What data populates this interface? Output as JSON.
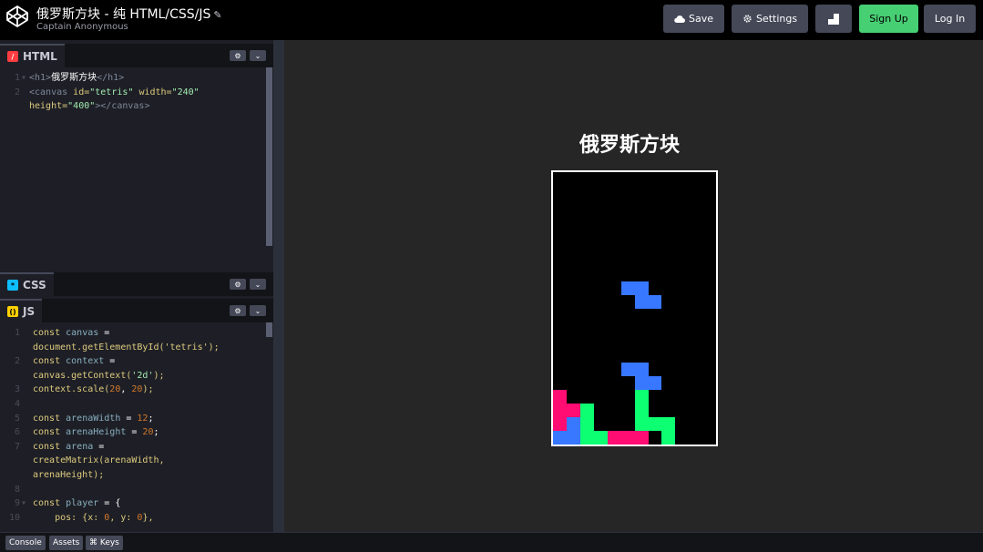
{
  "app": {
    "title": "俄罗斯方块 - 纯 HTML/CSS/JS",
    "author": "Captain Anonymous"
  },
  "toolbar": {
    "save_label": "Save",
    "settings_label": "Settings",
    "signup_label": "Sign Up",
    "login_label": "Log In"
  },
  "panes": {
    "html": {
      "label": "HTML",
      "badge": "/"
    },
    "css": {
      "label": "CSS",
      "badge": "*"
    },
    "js": {
      "label": "JS",
      "badge": "()"
    }
  },
  "html_code": {
    "line1_num": "1",
    "line2_num": "2",
    "line1_open": "<h1>",
    "line1_text": "俄罗斯方块",
    "line1_close": "</h1>",
    "line2_tag": "<canvas",
    "line2_id_attr": " id=",
    "line2_id_val": "\"tetris\"",
    "line2_w_attr": " width=",
    "line2_w_val": "\"240\"",
    "line2b_h_attr": "height=",
    "line2b_h_val": "\"400\"",
    "line2b_close": "></canvas>"
  },
  "js_code": {
    "nums": [
      "1",
      "2",
      "3",
      "4",
      "5",
      "6",
      "7",
      "8",
      "9",
      "10"
    ],
    "kw_const": "const",
    "canvas_var": " canvas",
    "eq": " =",
    "doc_line": "document.getElementById('tetris');",
    "context_var": " context",
    "getctx_pre": "canvas.getContext(",
    "getctx_arg": "'2d'",
    "getctx_post": ");",
    "scale_pre": "context.scale(",
    "scale_a": "20",
    "comma": ", ",
    "scale_b": "20",
    "scale_post": ");",
    "aw_var": " arenaWidth",
    "aw_eq": " = ",
    "aw_val": "12",
    "semi": ";",
    "ah_var": " arenaHeight",
    "ah_val": "20",
    "arena_var": " arena",
    "cm_line": "createMatrix(arenaWidth,",
    "ah_line": "arenaHeight);",
    "player_var": " player",
    "player_open": " = {",
    "pos_pre": "    pos: {x: ",
    "pos_x": "0",
    "pos_mid": ", y: ",
    "pos_y": "0",
    "pos_post": "},"
  },
  "preview": {
    "heading": "俄罗斯方块",
    "board_cols": 12,
    "board_rows": 20,
    "colors": {
      "blue": "#3877ff",
      "green": "#0dff72",
      "pink": "#ff0d72"
    },
    "cells": [
      {
        "c": 5,
        "r": 8,
        "color": "blue"
      },
      {
        "c": 6,
        "r": 8,
        "color": "blue"
      },
      {
        "c": 6,
        "r": 9,
        "color": "blue"
      },
      {
        "c": 7,
        "r": 9,
        "color": "blue"
      },
      {
        "c": 5,
        "r": 14,
        "color": "blue"
      },
      {
        "c": 6,
        "r": 14,
        "color": "blue"
      },
      {
        "c": 6,
        "r": 15,
        "color": "blue"
      },
      {
        "c": 7,
        "r": 15,
        "color": "blue"
      },
      {
        "c": 0,
        "r": 16,
        "color": "pink"
      },
      {
        "c": 0,
        "r": 17,
        "color": "pink"
      },
      {
        "c": 1,
        "r": 17,
        "color": "pink"
      },
      {
        "c": 0,
        "r": 18,
        "color": "pink"
      },
      {
        "c": 1,
        "r": 18,
        "color": "blue"
      },
      {
        "c": 0,
        "r": 19,
        "color": "blue"
      },
      {
        "c": 1,
        "r": 19,
        "color": "blue"
      },
      {
        "c": 2,
        "r": 17,
        "color": "green"
      },
      {
        "c": 2,
        "r": 18,
        "color": "green"
      },
      {
        "c": 2,
        "r": 19,
        "color": "green"
      },
      {
        "c": 3,
        "r": 19,
        "color": "green"
      },
      {
        "c": 4,
        "r": 19,
        "color": "pink"
      },
      {
        "c": 5,
        "r": 19,
        "color": "pink"
      },
      {
        "c": 6,
        "r": 19,
        "color": "pink"
      },
      {
        "c": 6,
        "r": 16,
        "color": "green"
      },
      {
        "c": 6,
        "r": 17,
        "color": "green"
      },
      {
        "c": 6,
        "r": 18,
        "color": "green"
      },
      {
        "c": 7,
        "r": 18,
        "color": "green"
      },
      {
        "c": 8,
        "r": 18,
        "color": "green"
      },
      {
        "c": 8,
        "r": 19,
        "color": "green"
      }
    ]
  },
  "bottom": {
    "console_label": "Console",
    "assets_label": "Assets",
    "keys_label": "⌘ Keys"
  }
}
